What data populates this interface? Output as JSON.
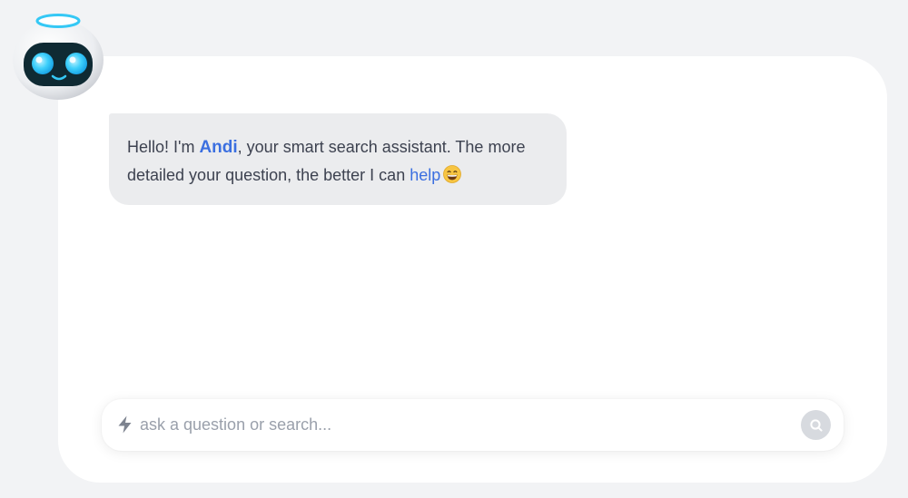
{
  "assistant": {
    "avatar_icon": "robot-avatar-icon"
  },
  "message": {
    "greeting": "Hello! I'm ",
    "name": "Andi",
    "middle": ", your smart search assistant. The more detailed your question, the better I can ",
    "link": "help",
    "emoji_icon": "grinning-face-icon"
  },
  "search": {
    "placeholder": "ask a question or search...",
    "value": "",
    "left_icon": "bolt-icon",
    "button_icon": "search-icon"
  },
  "colors": {
    "page_background": "#f2f3f5",
    "panel_background": "#ffffff",
    "bubble_background": "#ebecee",
    "accent": "#3b6fe0",
    "text": "#3d4250",
    "placeholder": "#9aa0ab",
    "robot_eye": "#35c8f5"
  }
}
